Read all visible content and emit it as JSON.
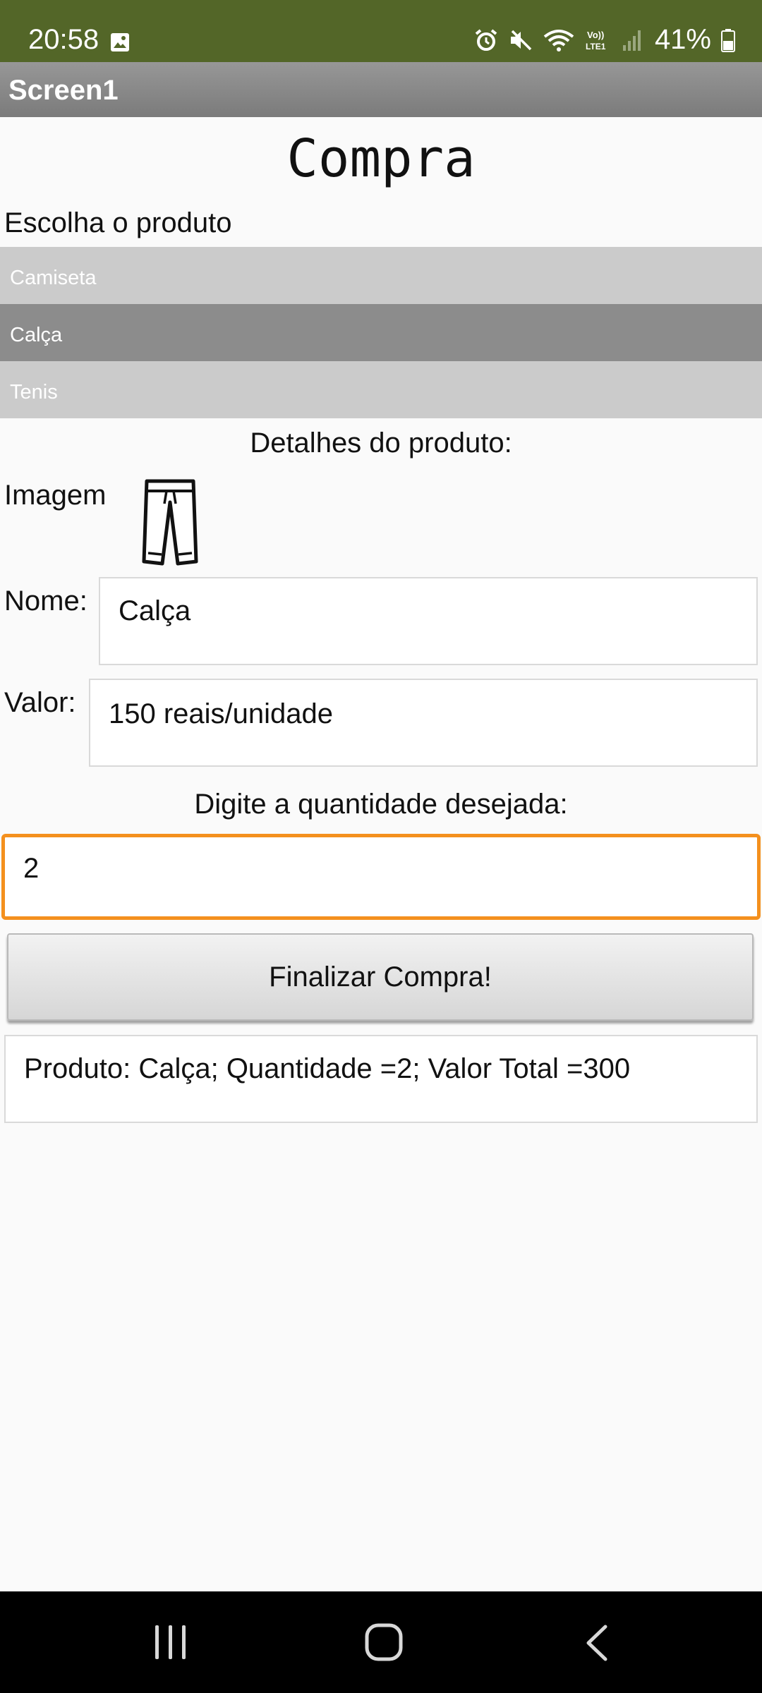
{
  "status_bar": {
    "time": "20:58",
    "battery": "41%"
  },
  "app_bar": {
    "title": "Screen1"
  },
  "main": {
    "heading": "Compra",
    "choose_label": "Escolha o produto",
    "products": [
      "Camiseta",
      "Calça",
      "Tenis"
    ],
    "selected_index": 1,
    "details_label": "Detalhes do produto:",
    "image_label": "Imagem",
    "image_icon": "pants-icon",
    "name_label": "Nome:",
    "name_value": "Calça",
    "price_label": "Valor:",
    "price_value": "150 reais/unidade",
    "quantity_prompt": "Digite a quantidade desejada:",
    "quantity_value": "2",
    "finish_button": "Finalizar Compra!",
    "result_text": "Produto: Calça; Quantidade =2; Valor Total =300"
  },
  "colors": {
    "status_bar": "#536628",
    "focus_border": "#f4901e",
    "selected_item": "#8c8c8c",
    "list_item": "#cbcbcb"
  }
}
